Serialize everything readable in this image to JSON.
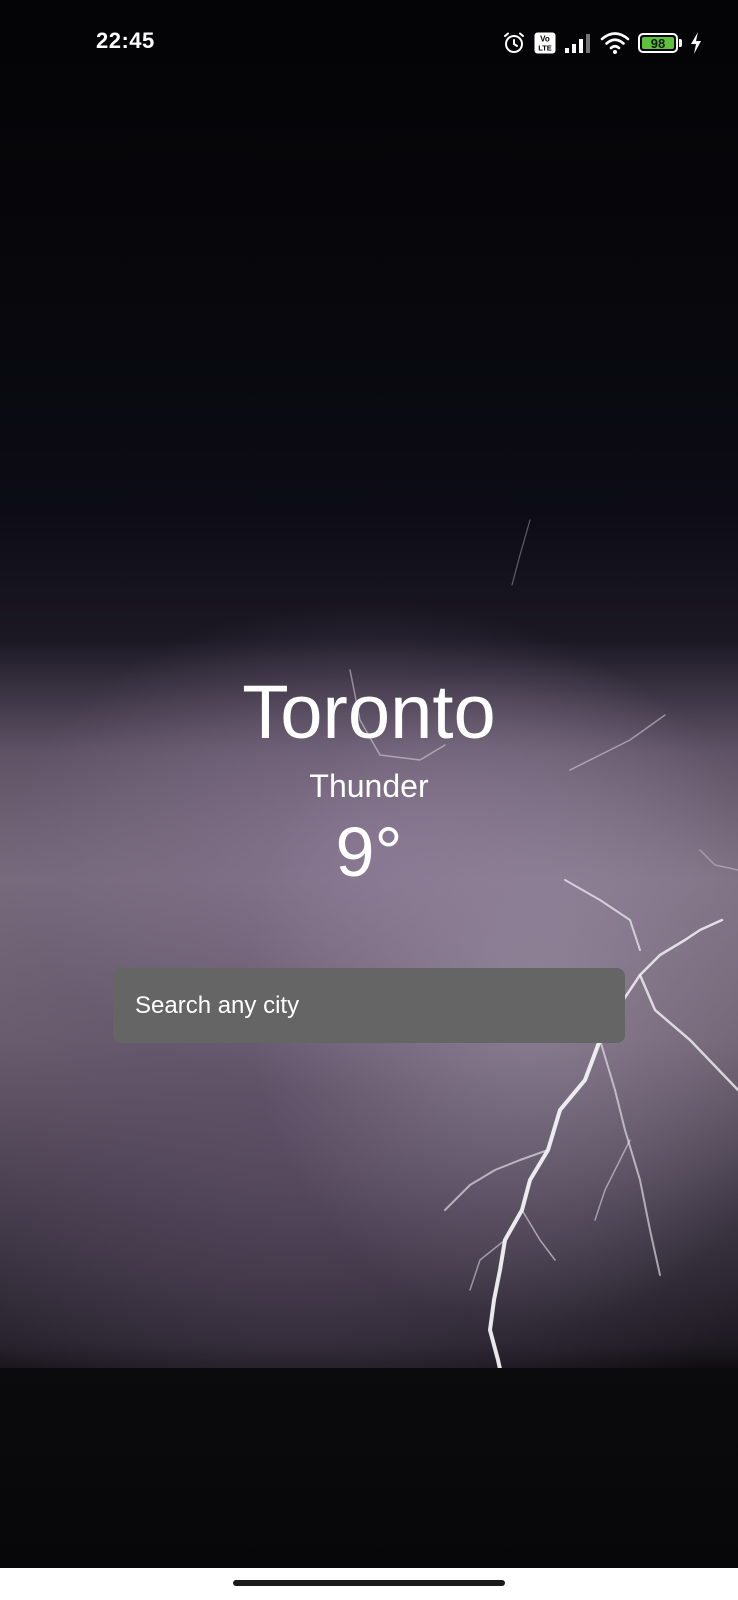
{
  "status_bar": {
    "time": "22:45",
    "battery_level": "98",
    "network_badge": "Vo LTE",
    "icons": [
      "alarm-icon",
      "volte-icon",
      "signal-icon",
      "wifi-icon",
      "battery-icon",
      "charging-icon"
    ]
  },
  "weather": {
    "city": "Toronto",
    "condition": "Thunder",
    "temperature": "9°"
  },
  "search": {
    "placeholder": "Search any city",
    "value": ""
  },
  "colors": {
    "search_background": "#656565",
    "battery_fill": "#5fc03d",
    "text": "#ffffff"
  }
}
